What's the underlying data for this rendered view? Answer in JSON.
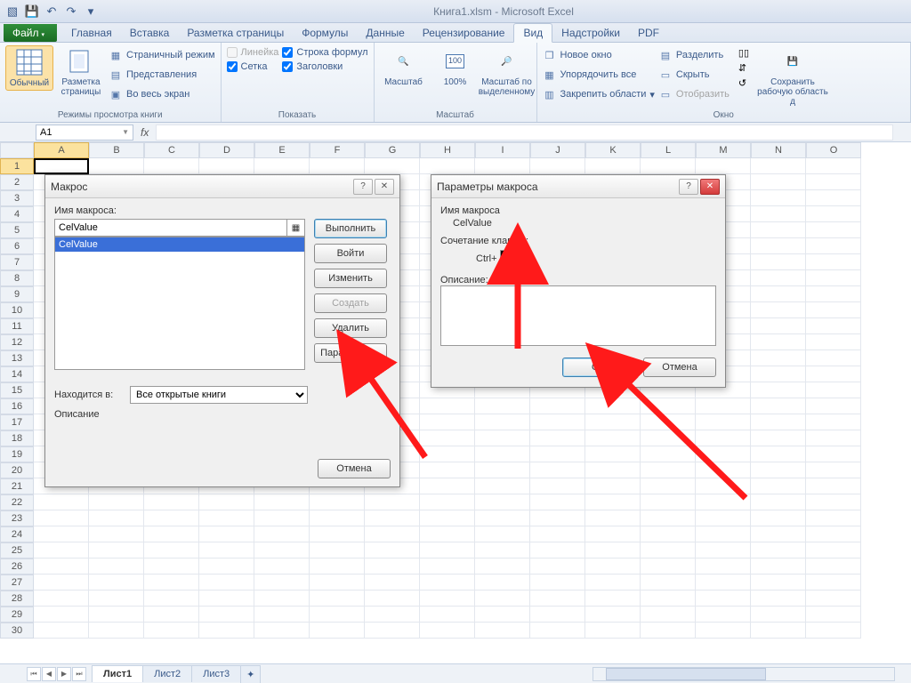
{
  "title": "Книга1.xlsm  -  Microsoft Excel",
  "tabs": {
    "file": "Файл",
    "items": [
      "Главная",
      "Вставка",
      "Разметка страницы",
      "Формулы",
      "Данные",
      "Рецензирование",
      "Вид",
      "Надстройки",
      "PDF"
    ],
    "active_index": 6
  },
  "ribbon": {
    "views": {
      "normal": "Обычный",
      "page_layout": "Разметка\nстраницы",
      "page_break": "Страничный режим",
      "custom": "Представления",
      "full": "Во весь экран",
      "group": "Режимы просмотра книги"
    },
    "show": {
      "ruler": "Линейка",
      "grid": "Сетка",
      "formula_bar": "Строка формул",
      "headings": "Заголовки",
      "group": "Показать"
    },
    "zoom": {
      "zoom": "Масштаб",
      "hundred": "100%",
      "selection": "Масштаб по\nвыделенному",
      "group": "Масштаб"
    },
    "window": {
      "new": "Новое окно",
      "arrange": "Упорядочить все",
      "freeze": "Закрепить области",
      "split": "Разделить",
      "hide": "Скрыть",
      "unhide": "Отобразить",
      "save_ws": "Сохранить\nрабочую область д",
      "group": "Окно"
    }
  },
  "name_box": "A1",
  "fx_label": "fx",
  "columns": [
    "A",
    "B",
    "C",
    "D",
    "E",
    "F",
    "G",
    "H",
    "I",
    "J",
    "K",
    "L",
    "M",
    "N",
    "O"
  ],
  "dialog_macros": {
    "title": "Макрос",
    "name_label": "Имя макроса:",
    "name_value": "CelValue",
    "list": [
      "CelValue"
    ],
    "buttons": {
      "run": "Выполнить",
      "step": "Войти",
      "edit": "Изменить",
      "create": "Создать",
      "delete": "Удалить",
      "options": "Параметры..."
    },
    "location_label": "Находится в:",
    "location_value": "Все открытые книги",
    "desc_label": "Описание",
    "cancel": "Отмена"
  },
  "dialog_options": {
    "title": "Параметры макроса",
    "name_label": "Имя макроса",
    "name_value": "CelValue",
    "shortcut_label": "Сочетание клавиш:",
    "shortcut_prefix": "Ctrl+",
    "shortcut_key": "A",
    "desc_label": "Описание:",
    "desc_value": "",
    "ok": "OK",
    "cancel": "Отмена"
  },
  "sheets": [
    "Лист1",
    "Лист2",
    "Лист3"
  ]
}
